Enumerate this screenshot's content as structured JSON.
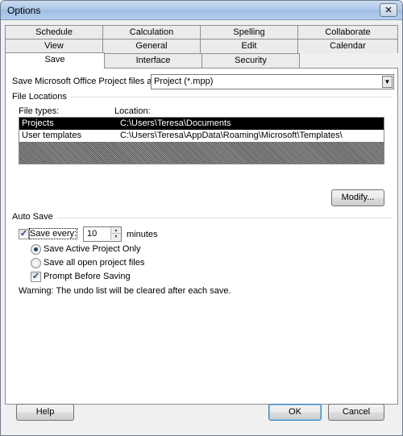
{
  "window": {
    "title": "Options"
  },
  "tabs": {
    "row1": [
      "Schedule",
      "Calculation",
      "Spelling",
      "Collaborate"
    ],
    "row2": [
      "View",
      "General",
      "Edit",
      "Calendar"
    ],
    "row3": [
      "Save",
      "Interface",
      "Security"
    ],
    "active": "Save"
  },
  "save_format": {
    "label": "Save Microsoft Office Project files as:",
    "value": "Project (*.mpp)"
  },
  "file_locations": {
    "heading": "File Locations",
    "col_types": "File types:",
    "col_location": "Location:",
    "rows": [
      {
        "type": "Projects",
        "location": "C:\\Users\\Teresa\\Documents",
        "selected": true
      },
      {
        "type": "User templates",
        "location": "C:\\Users\\Teresa\\AppData\\Roaming\\Microsoft\\Templates\\",
        "selected": false
      }
    ],
    "modify_label": "Modify..."
  },
  "auto_save": {
    "heading": "Auto Save",
    "save_every_label": "Save every:",
    "save_every_checked": true,
    "minutes_value": "10",
    "minutes_label": "minutes",
    "option_active": "Save Active Project Only",
    "option_all": "Save all open project files",
    "selected_option": "active",
    "prompt_label": "Prompt Before Saving",
    "prompt_checked": true,
    "warning": "Warning: The undo list will be cleared after each save."
  },
  "footer": {
    "help": "Help",
    "ok": "OK",
    "cancel": "Cancel"
  }
}
